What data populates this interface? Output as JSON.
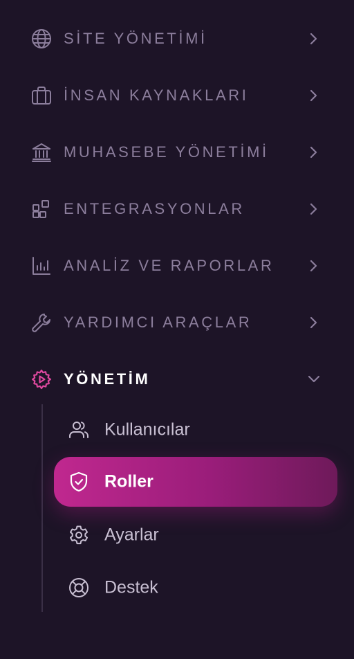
{
  "colors": {
    "background": "#1d1427",
    "muted_text": "#8c7e9c",
    "active_icon": "#e0489f",
    "selected_gradient_start": "#c0288f",
    "selected_gradient_end": "#6e1a5a"
  },
  "menu": {
    "items": [
      {
        "label": "SİTE YÖNETİMİ",
        "icon": "globe-icon",
        "expanded": false
      },
      {
        "label": "İNSAN KAYNAKLARI",
        "icon": "briefcase-icon",
        "expanded": false
      },
      {
        "label": "MUHASEBE YÖNETİMİ",
        "icon": "bank-icon",
        "expanded": false
      },
      {
        "label": "ENTEGRASYONLAR",
        "icon": "grid-plus-icon",
        "expanded": false
      },
      {
        "label": "ANALİZ VE RAPORLAR",
        "icon": "bar-chart-icon",
        "expanded": false
      },
      {
        "label": "YARDIMCI ARAÇLAR",
        "icon": "wrench-icon",
        "expanded": false
      },
      {
        "label": "YÖNETİM",
        "icon": "gear-play-icon",
        "expanded": true
      }
    ],
    "submenu": {
      "items": [
        {
          "label": "Kullanıcılar",
          "icon": "users-icon",
          "selected": false
        },
        {
          "label": "Roller",
          "icon": "shield-check-icon",
          "selected": true
        },
        {
          "label": "Ayarlar",
          "icon": "gear-icon",
          "selected": false
        },
        {
          "label": "Destek",
          "icon": "lifebuoy-icon",
          "selected": false
        }
      ]
    }
  }
}
